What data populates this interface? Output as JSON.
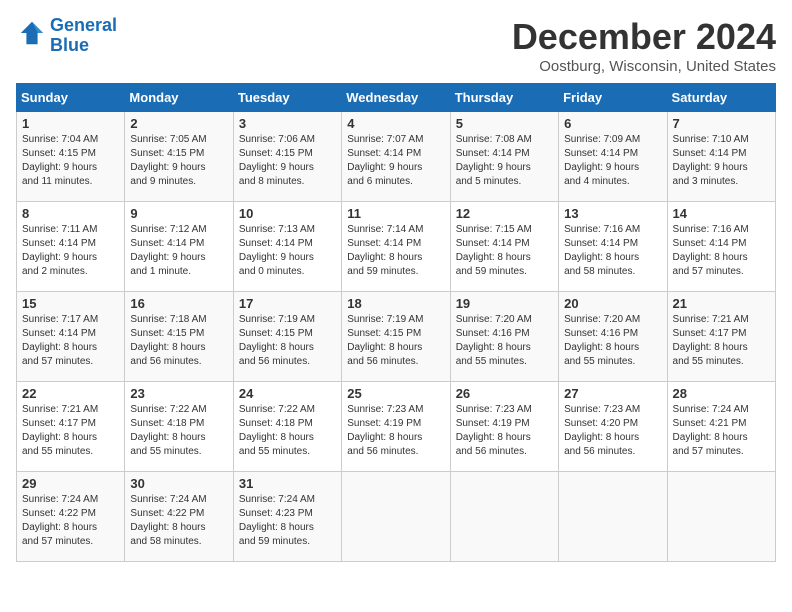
{
  "logo": {
    "text_general": "General",
    "text_blue": "Blue"
  },
  "title": "December 2024",
  "subtitle": "Oostburg, Wisconsin, United States",
  "days_of_week": [
    "Sunday",
    "Monday",
    "Tuesday",
    "Wednesday",
    "Thursday",
    "Friday",
    "Saturday"
  ],
  "weeks": [
    [
      {
        "day": "1",
        "info": "Sunrise: 7:04 AM\nSunset: 4:15 PM\nDaylight: 9 hours\nand 11 minutes."
      },
      {
        "day": "2",
        "info": "Sunrise: 7:05 AM\nSunset: 4:15 PM\nDaylight: 9 hours\nand 9 minutes."
      },
      {
        "day": "3",
        "info": "Sunrise: 7:06 AM\nSunset: 4:15 PM\nDaylight: 9 hours\nand 8 minutes."
      },
      {
        "day": "4",
        "info": "Sunrise: 7:07 AM\nSunset: 4:14 PM\nDaylight: 9 hours\nand 6 minutes."
      },
      {
        "day": "5",
        "info": "Sunrise: 7:08 AM\nSunset: 4:14 PM\nDaylight: 9 hours\nand 5 minutes."
      },
      {
        "day": "6",
        "info": "Sunrise: 7:09 AM\nSunset: 4:14 PM\nDaylight: 9 hours\nand 4 minutes."
      },
      {
        "day": "7",
        "info": "Sunrise: 7:10 AM\nSunset: 4:14 PM\nDaylight: 9 hours\nand 3 minutes."
      }
    ],
    [
      {
        "day": "8",
        "info": "Sunrise: 7:11 AM\nSunset: 4:14 PM\nDaylight: 9 hours\nand 2 minutes."
      },
      {
        "day": "9",
        "info": "Sunrise: 7:12 AM\nSunset: 4:14 PM\nDaylight: 9 hours\nand 1 minute."
      },
      {
        "day": "10",
        "info": "Sunrise: 7:13 AM\nSunset: 4:14 PM\nDaylight: 9 hours\nand 0 minutes."
      },
      {
        "day": "11",
        "info": "Sunrise: 7:14 AM\nSunset: 4:14 PM\nDaylight: 8 hours\nand 59 minutes."
      },
      {
        "day": "12",
        "info": "Sunrise: 7:15 AM\nSunset: 4:14 PM\nDaylight: 8 hours\nand 59 minutes."
      },
      {
        "day": "13",
        "info": "Sunrise: 7:16 AM\nSunset: 4:14 PM\nDaylight: 8 hours\nand 58 minutes."
      },
      {
        "day": "14",
        "info": "Sunrise: 7:16 AM\nSunset: 4:14 PM\nDaylight: 8 hours\nand 57 minutes."
      }
    ],
    [
      {
        "day": "15",
        "info": "Sunrise: 7:17 AM\nSunset: 4:14 PM\nDaylight: 8 hours\nand 57 minutes."
      },
      {
        "day": "16",
        "info": "Sunrise: 7:18 AM\nSunset: 4:15 PM\nDaylight: 8 hours\nand 56 minutes."
      },
      {
        "day": "17",
        "info": "Sunrise: 7:19 AM\nSunset: 4:15 PM\nDaylight: 8 hours\nand 56 minutes."
      },
      {
        "day": "18",
        "info": "Sunrise: 7:19 AM\nSunset: 4:15 PM\nDaylight: 8 hours\nand 56 minutes."
      },
      {
        "day": "19",
        "info": "Sunrise: 7:20 AM\nSunset: 4:16 PM\nDaylight: 8 hours\nand 55 minutes."
      },
      {
        "day": "20",
        "info": "Sunrise: 7:20 AM\nSunset: 4:16 PM\nDaylight: 8 hours\nand 55 minutes."
      },
      {
        "day": "21",
        "info": "Sunrise: 7:21 AM\nSunset: 4:17 PM\nDaylight: 8 hours\nand 55 minutes."
      }
    ],
    [
      {
        "day": "22",
        "info": "Sunrise: 7:21 AM\nSunset: 4:17 PM\nDaylight: 8 hours\nand 55 minutes."
      },
      {
        "day": "23",
        "info": "Sunrise: 7:22 AM\nSunset: 4:18 PM\nDaylight: 8 hours\nand 55 minutes."
      },
      {
        "day": "24",
        "info": "Sunrise: 7:22 AM\nSunset: 4:18 PM\nDaylight: 8 hours\nand 55 minutes."
      },
      {
        "day": "25",
        "info": "Sunrise: 7:23 AM\nSunset: 4:19 PM\nDaylight: 8 hours\nand 56 minutes."
      },
      {
        "day": "26",
        "info": "Sunrise: 7:23 AM\nSunset: 4:19 PM\nDaylight: 8 hours\nand 56 minutes."
      },
      {
        "day": "27",
        "info": "Sunrise: 7:23 AM\nSunset: 4:20 PM\nDaylight: 8 hours\nand 56 minutes."
      },
      {
        "day": "28",
        "info": "Sunrise: 7:24 AM\nSunset: 4:21 PM\nDaylight: 8 hours\nand 57 minutes."
      }
    ],
    [
      {
        "day": "29",
        "info": "Sunrise: 7:24 AM\nSunset: 4:22 PM\nDaylight: 8 hours\nand 57 minutes."
      },
      {
        "day": "30",
        "info": "Sunrise: 7:24 AM\nSunset: 4:22 PM\nDaylight: 8 hours\nand 58 minutes."
      },
      {
        "day": "31",
        "info": "Sunrise: 7:24 AM\nSunset: 4:23 PM\nDaylight: 8 hours\nand 59 minutes."
      },
      {
        "day": "",
        "info": ""
      },
      {
        "day": "",
        "info": ""
      },
      {
        "day": "",
        "info": ""
      },
      {
        "day": "",
        "info": ""
      }
    ]
  ]
}
